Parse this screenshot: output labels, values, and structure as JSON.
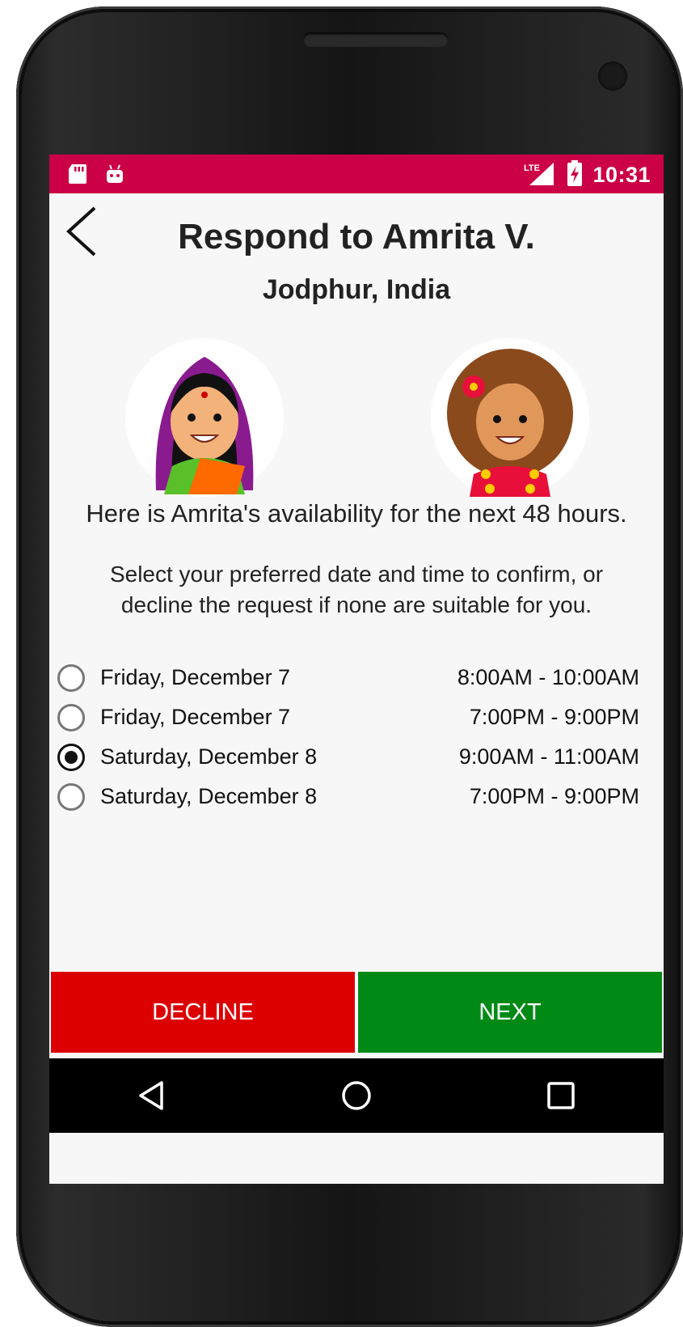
{
  "status_bar": {
    "time": "10:31",
    "network": "LTE",
    "color": "#cc0046",
    "left_icons": [
      "sd-card-icon",
      "android-icon"
    ],
    "right_icons": [
      "lte-signal-icon",
      "battery-charging-icon"
    ]
  },
  "header": {
    "back_icon": "chevron-left-icon",
    "title": "Respond to Amrita V.",
    "subtitle": "Jodphur, India"
  },
  "avatars": [
    {
      "name": "requester-avatar"
    },
    {
      "name": "user-avatar"
    }
  ],
  "body": {
    "availability_text": "Here is Amrita's availability for the next 48 hours.",
    "instructions": "Select your preferred date and time to confirm, or decline the request if none are suitable for you."
  },
  "slots": [
    {
      "date": "Friday, December 7",
      "time": "8:00AM - 10:00AM",
      "selected": false
    },
    {
      "date": "Friday, December 7",
      "time": "7:00PM - 9:00PM",
      "selected": false
    },
    {
      "date": "Saturday, December 8",
      "time": "9:00AM - 11:00AM",
      "selected": true
    },
    {
      "date": "Saturday, December 8",
      "time": "7:00PM - 9:00PM",
      "selected": false
    }
  ],
  "actions": {
    "decline_label": "DECLINE",
    "next_label": "NEXT",
    "decline_color": "#dd0000",
    "next_color": "#008a15"
  },
  "nav_bar": {
    "icons": [
      "back-triangle-icon",
      "home-circle-icon",
      "recents-square-icon"
    ]
  }
}
